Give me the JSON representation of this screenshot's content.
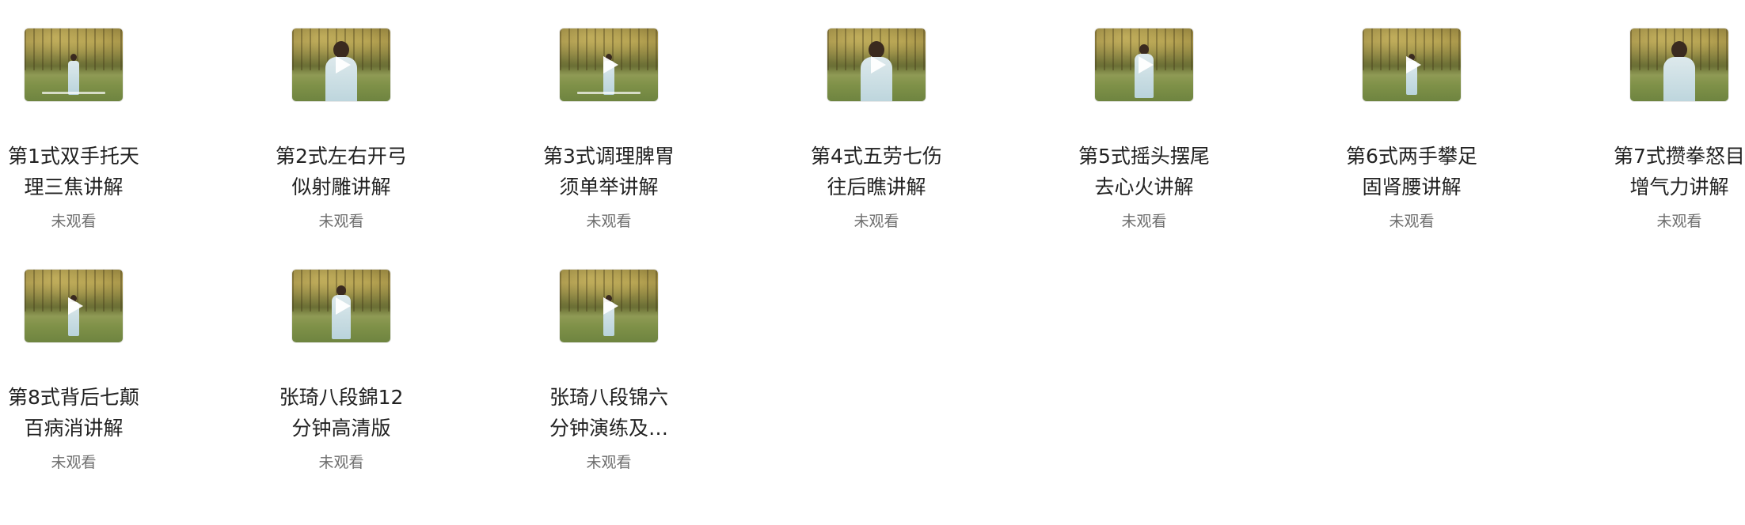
{
  "videos": [
    {
      "title": "第1式双手托天理三焦讲解",
      "status": "未观看",
      "thumbnail": "video-thumbnail",
      "play_icon": "play-icon"
    },
    {
      "title": "第2式左右开弓似射雕讲解",
      "status": "未观看",
      "thumbnail": "video-thumbnail",
      "play_icon": "play-icon"
    },
    {
      "title": "第3式调理脾胃须单举讲解",
      "status": "未观看",
      "thumbnail": "video-thumbnail",
      "play_icon": "play-icon"
    },
    {
      "title": "第4式五劳七伤往后瞧讲解",
      "status": "未观看",
      "thumbnail": "video-thumbnail",
      "play_icon": "play-icon"
    },
    {
      "title": "第5式摇头摆尾去心火讲解",
      "status": "未观看",
      "thumbnail": "video-thumbnail",
      "play_icon": "play-icon"
    },
    {
      "title": "第6式两手攀足固肾腰讲解",
      "status": "未观看",
      "thumbnail": "video-thumbnail",
      "play_icon": "play-icon"
    },
    {
      "title": "第7式攒拳怒目增气力讲解",
      "status": "未观看",
      "thumbnail": "video-thumbnail",
      "play_icon": "play-icon"
    },
    {
      "title": "第8式背后七颠百病消讲解",
      "status": "未观看",
      "thumbnail": "video-thumbnail",
      "play_icon": "play-icon"
    },
    {
      "title": "张琦八段錦12分钟高清版",
      "status": "未观看",
      "thumbnail": "video-thumbnail",
      "play_icon": "play-icon"
    },
    {
      "title": "张琦八段锦六分钟演练及讲解",
      "status": "未观看",
      "thumbnail": "video-thumbnail",
      "play_icon": "play-icon"
    }
  ]
}
